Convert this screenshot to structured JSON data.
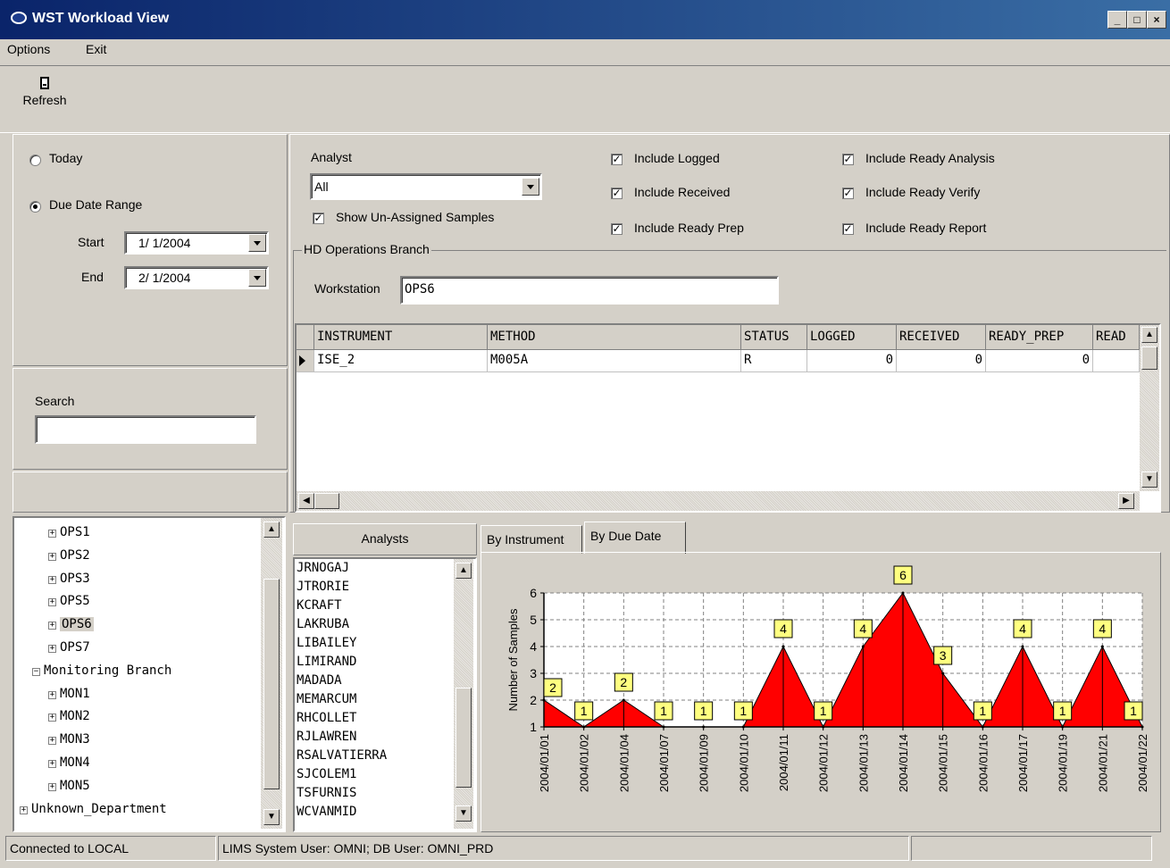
{
  "window": {
    "title": "WST Workload View",
    "controls": [
      "_",
      "□",
      "×"
    ]
  },
  "menu": {
    "items": [
      "Options",
      "Exit"
    ]
  },
  "toolbar": {
    "refresh_label": "Refresh"
  },
  "date_filter": {
    "today_label": "Today",
    "range_label": "Due Date Range",
    "selected": "Due Date Range",
    "start_label": "Start",
    "start_value": "1/ 1/2004",
    "end_label": "End",
    "end_value": "2/ 1/2004"
  },
  "search": {
    "label": "Search",
    "value": ""
  },
  "analyst_filter": {
    "label": "Analyst",
    "value": "All",
    "show_unassigned_label": "Show Un-Assigned Samples",
    "show_unassigned": true
  },
  "includes": [
    {
      "label": "Include Logged",
      "checked": true
    },
    {
      "label": "Include Received",
      "checked": true
    },
    {
      "label": "Include Ready Prep",
      "checked": true
    },
    {
      "label": "Include Ready Analysis",
      "checked": true
    },
    {
      "label": "Include Ready Verify",
      "checked": true
    },
    {
      "label": "Include Ready Report",
      "checked": true
    }
  ],
  "branch": {
    "title": "HD Operations Branch",
    "workstation_label": "Workstation",
    "workstation_value": "OPS6"
  },
  "grid": {
    "columns": [
      "INSTRUMENT",
      "METHOD",
      "STATUS",
      "LOGGED",
      "RECEIVED",
      "READY_PREP",
      "READ"
    ],
    "rows": [
      [
        "ISE_2",
        "M005A",
        "R",
        "0",
        "0",
        "0",
        ""
      ]
    ]
  },
  "tree": {
    "items": [
      {
        "label": "OPS1",
        "level": 2,
        "expander": "+"
      },
      {
        "label": "OPS2",
        "level": 2,
        "expander": "+"
      },
      {
        "label": "OPS3",
        "level": 2,
        "expander": "+"
      },
      {
        "label": "OPS5",
        "level": 2,
        "expander": "+"
      },
      {
        "label": "OPS6",
        "level": 2,
        "expander": "+",
        "selected": true
      },
      {
        "label": "OPS7",
        "level": 2,
        "expander": "+"
      },
      {
        "label": "Monitoring Branch",
        "level": 1,
        "expander": "−"
      },
      {
        "label": "MON1",
        "level": 2,
        "expander": "+"
      },
      {
        "label": "MON2",
        "level": 2,
        "expander": "+"
      },
      {
        "label": "MON3",
        "level": 2,
        "expander": "+"
      },
      {
        "label": "MON4",
        "level": 2,
        "expander": "+"
      },
      {
        "label": "MON5",
        "level": 2,
        "expander": "+"
      },
      {
        "label": "Unknown_Department",
        "level": 0,
        "expander": "+"
      }
    ]
  },
  "analysts": {
    "header": "Analysts",
    "items": [
      "JRNOGAJ",
      "JTRORIE",
      "KCRAFT",
      "LAKRUBA",
      "LIBAILEY",
      "LIMIRAND",
      "MADADA",
      "MEMARCUM",
      "RHCOLLET",
      "RJLAWREN",
      "RSALVATIERRA",
      "SJCOLEM1",
      "TSFURNIS",
      "WCVANMID"
    ]
  },
  "tabs": {
    "items": [
      "By Instrument",
      "By Due Date"
    ],
    "active": "By Due Date"
  },
  "chart_data": {
    "type": "area",
    "ylabel": "Number of Samples",
    "xlabel": "",
    "ylim": [
      1,
      6
    ],
    "grid": true,
    "categories": [
      "2004/01/01",
      "2004/01/02",
      "2004/01/04",
      "2004/01/07",
      "2004/01/09",
      "2004/01/10",
      "2004/01/11",
      "2004/01/12",
      "2004/01/13",
      "2004/01/14",
      "2004/01/15",
      "2004/01/16",
      "2004/01/17",
      "2004/01/19",
      "2004/01/21",
      "2004/01/22"
    ],
    "values": [
      2,
      1,
      2,
      1,
      1,
      1,
      4,
      1,
      4,
      6,
      3,
      1,
      4,
      1,
      4,
      1
    ],
    "yticks": [
      1,
      2,
      3,
      4,
      5,
      6
    ],
    "fill_color": "#ff0000",
    "label_color": "#ffff80"
  },
  "status": {
    "connection": "Connected to LOCAL",
    "user_info": "LIMS System User: OMNI; DB User: OMNI_PRD",
    "extra": ""
  }
}
